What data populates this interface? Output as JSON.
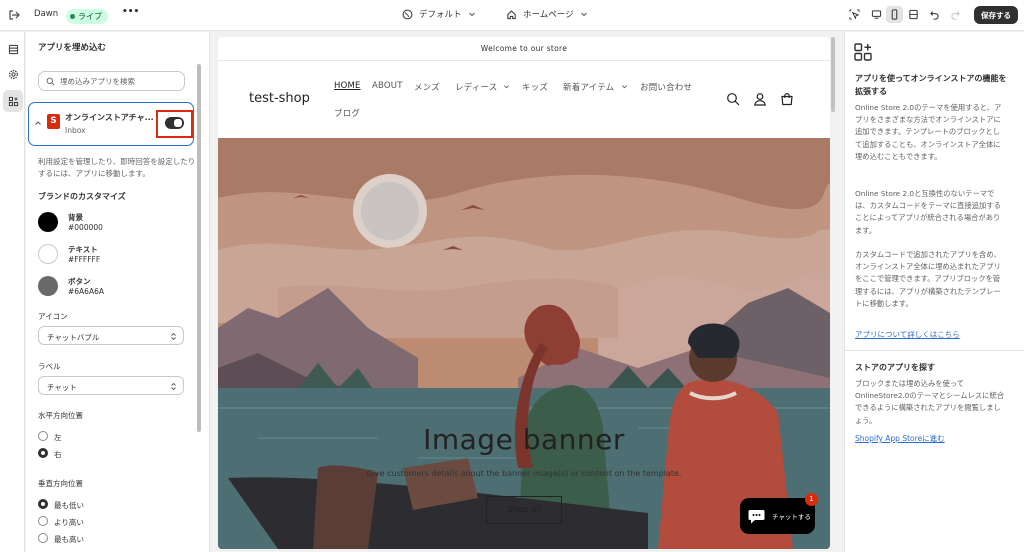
{
  "topbar": {
    "store_name": "Dawn",
    "live_badge": "ライブ",
    "more": "•••",
    "theme_select": "デフォルト",
    "page_select": "ホームページ",
    "save": "保存する"
  },
  "left": {
    "title": "アプリを埋め込む",
    "search_placeholder": "埋め込みアプリを検索",
    "app_name": "オンラインストアチャ...",
    "app_sub": "Inbox",
    "app_logo": "S",
    "toggle_on": true,
    "desc": "利用設定を管理したり、即時回答を設定したりするには、アプリに移動します。",
    "brand_heading": "ブランドのカスタマイズ",
    "colors": [
      {
        "label": "背景",
        "hex": "#000000",
        "color": "#000000"
      },
      {
        "label": "テキスト",
        "hex": "#FFFFFF",
        "color": "#ffffff"
      },
      {
        "label": "ボタン",
        "hex": "#6A6A6A",
        "color": "#6a6a6a"
      }
    ],
    "icon_label": "アイコン",
    "icon_value": "チャットバブル",
    "label_label": "ラベル",
    "label_value": "チャット",
    "hpos_label": "水平方向位置",
    "hpos_options": [
      "左",
      "右"
    ],
    "hpos_selected": "右",
    "vpos_label": "垂直方向位置",
    "vpos_options": [
      "最も低い",
      "より高い",
      "最も高い"
    ],
    "vpos_selected": "最も低い"
  },
  "preview": {
    "announcement": "Welcome to our store",
    "logo": "test-shop",
    "nav": [
      "HOME",
      "ABOUT",
      "メンズ",
      "レディース",
      "キッズ",
      "新着アイテム",
      "お問い合わせ",
      "ブログ"
    ],
    "banner_title": "Image banner",
    "banner_text": "Give customers details about the banner image(s) or content on the template.",
    "banner_button": "Shop all",
    "chat_label": "チャットする",
    "chat_badge": "1"
  },
  "right": {
    "title": "アプリを使ってオンラインストアの機能を拡張する",
    "p1": "Online Store 2.0のテーマを使用すると、アプリをさまざまな方法でオンラインストアに追加できます。テンプレートのブロックとして追加することも、オンラインストア全体に埋め込むこともできます。",
    "p2": "Online Store 2.0と互換性のないテーマでは、カスタムコードをテーマに直接追加することによってアプリが統合される場合があります。",
    "p3": "カスタムコードで追加されたアプリを含め、オンラインストア全体に埋め込まれたアプリをここで管理できます。アプリブロックを管理するには、アプリが構築されたテンプレートに移動します。",
    "link1": "アプリについて詳しくはこちら",
    "title2": "ストアのアプリを探す",
    "p4": "ブロックまたは埋め込みを使ってOnlineStore2.0のテーマとシームレスに統合できるように構築されたアプリを閲覧しましょう。",
    "link2": "Shopify App Storeに進む"
  },
  "icons": [
    "exit-icon",
    "sections-icon",
    "gear-icon",
    "apps-icon",
    "globe-icon",
    "home-icon",
    "inspector-icon",
    "desktop-icon",
    "mobile-icon",
    "fullscreen-icon",
    "undo-icon",
    "redo-icon",
    "search-icon",
    "account-icon",
    "cart-icon",
    "chat-icon",
    "apps-add-icon"
  ],
  "colors": {
    "accent": "#2c6ecb",
    "highlight_box": "#d72c0d",
    "banner_sky": "#b98b73"
  }
}
